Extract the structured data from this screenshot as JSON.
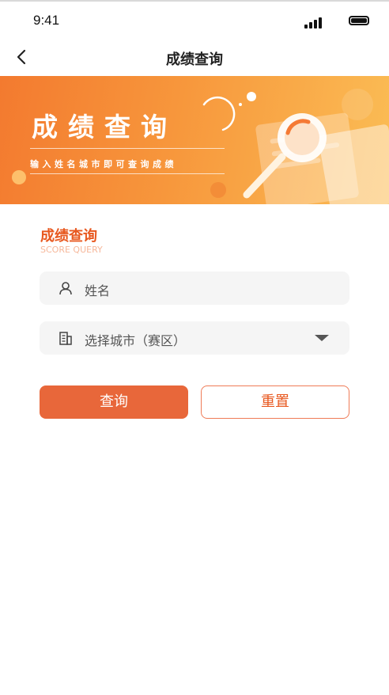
{
  "status_bar": {
    "time": "9:41",
    "icons": [
      "signal-icon",
      "battery-icon"
    ]
  },
  "nav": {
    "title": "成绩查询",
    "back_icon": "chevron-left-icon"
  },
  "banner": {
    "title": "成绩查询",
    "subtitle": "输入姓名城市即可查询成绩",
    "illustration": "magnifier-document-illustration"
  },
  "form": {
    "section_title": "成绩查询",
    "section_subtitle": "SCORE QUERY",
    "name_field": {
      "placeholder": "姓名",
      "icon": "user-icon"
    },
    "city_select": {
      "placeholder": "选择城市（赛区）",
      "icon": "building-icon",
      "caret_icon": "caret-down-icon"
    },
    "query_button": "查询",
    "reset_button": "重置"
  },
  "colors": {
    "accent": "#e8673a",
    "banner_start": "#f37a2f",
    "banner_end": "#fbbd55",
    "field_bg": "#f5f5f5"
  }
}
